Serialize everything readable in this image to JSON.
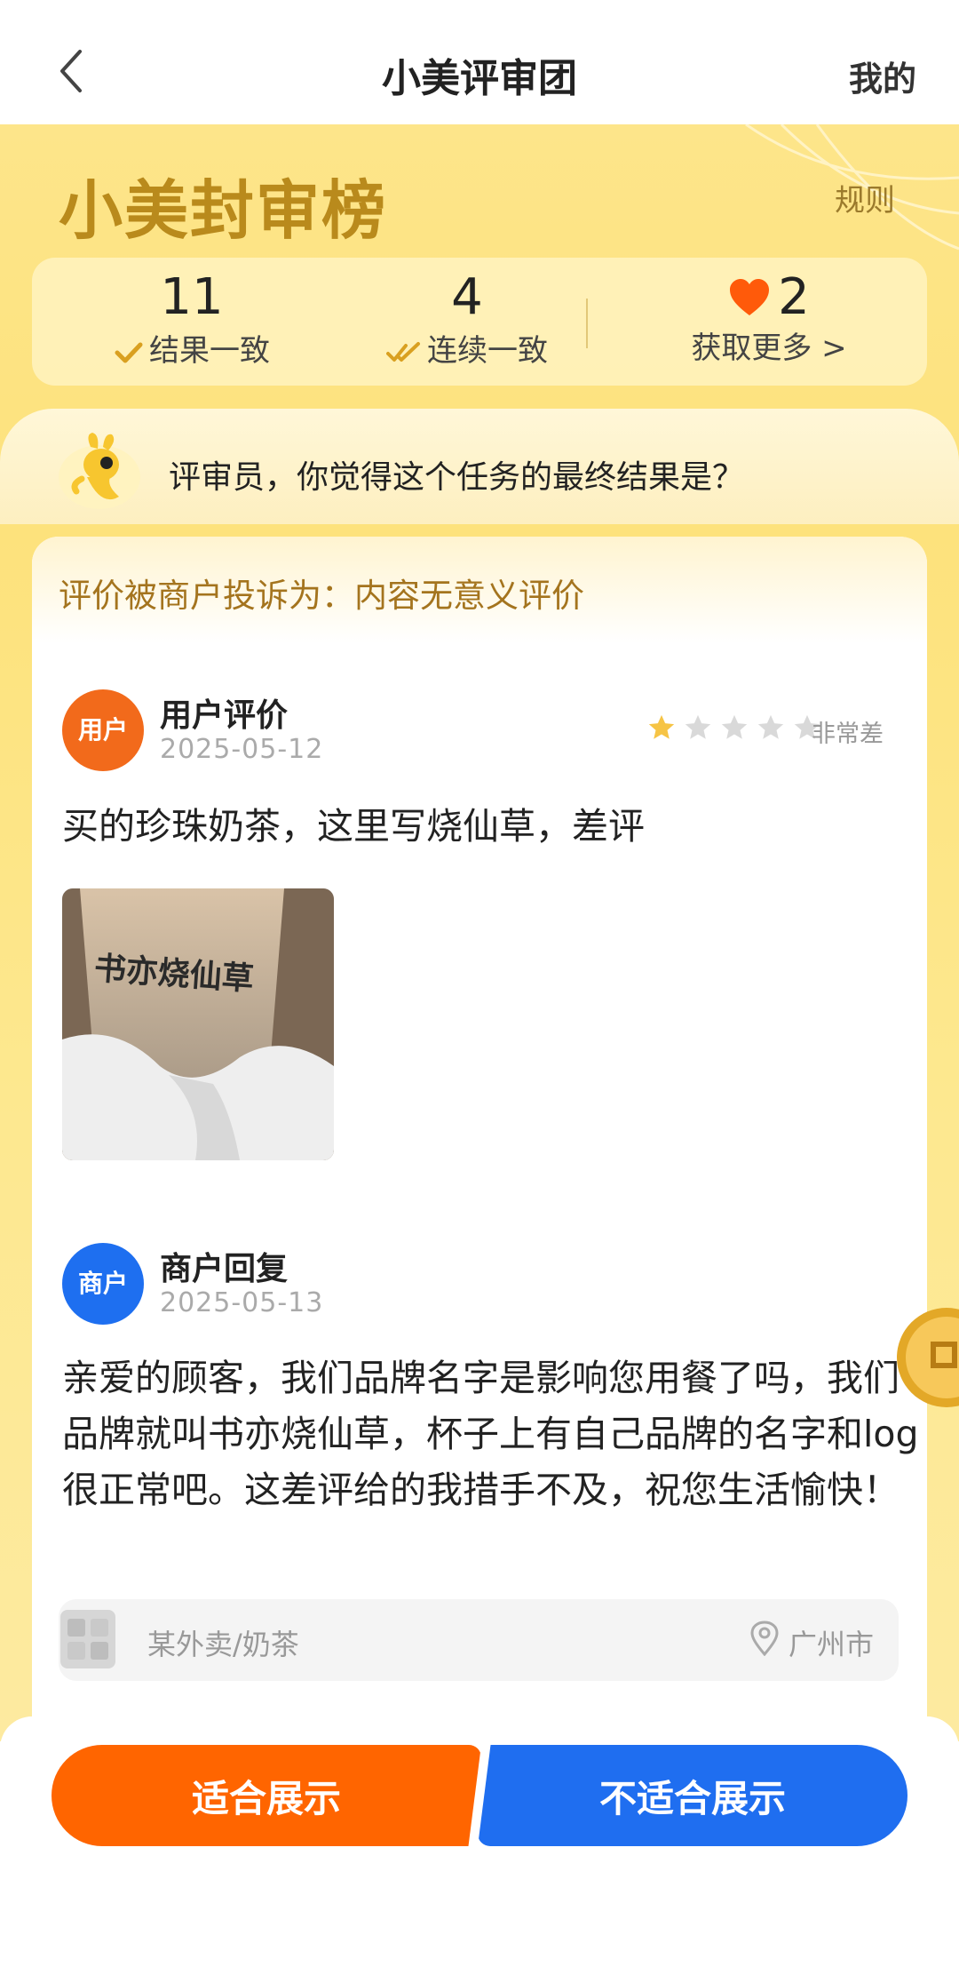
{
  "nav": {
    "title": "小美评审团",
    "mine": "我的"
  },
  "banner": {
    "logo_text": "小美封审榜",
    "rules": "规则"
  },
  "stats": {
    "consistent_count": "11",
    "consistent_label": "结果一致",
    "streak_count": "4",
    "streak_label": "连续一致",
    "hearts": "2",
    "get_more": "获取更多 >"
  },
  "question": "评审员，你觉得这个任务的最终结果是？",
  "complaint": "评价被商户投诉为：内容无意义评价",
  "user_review": {
    "avatar_label": "用户",
    "name": "用户评价",
    "date": "2025-05-12",
    "rating": 1,
    "rating_max": 5,
    "rating_label": "非常差",
    "text": "买的珍珠奶茶，这里写烧仙草，差评",
    "photo_caption": "书亦烧仙草"
  },
  "merchant_reply": {
    "avatar_label": "商户",
    "name": "商户回复",
    "date": "2025-05-13",
    "text": "亲爱的顾客，我们品牌名字是影响您用餐了吗，我们品牌就叫书亦烧仙草，杯子上有自己品牌的名字和log很正常吧。这差评给的我措手不及，祝您生活愉快！"
  },
  "store": {
    "category": "某外卖/奶茶",
    "city": "广州市"
  },
  "actions": {
    "fit": "适合展示",
    "unfit": "不适合展示"
  },
  "colors": {
    "orange": "#ff6500",
    "blue": "#1f6ef0",
    "gold": "#b98a1c",
    "complaint_text": "#a4741e",
    "star_on": "#f6c445",
    "star_off": "#d9d9d9"
  }
}
